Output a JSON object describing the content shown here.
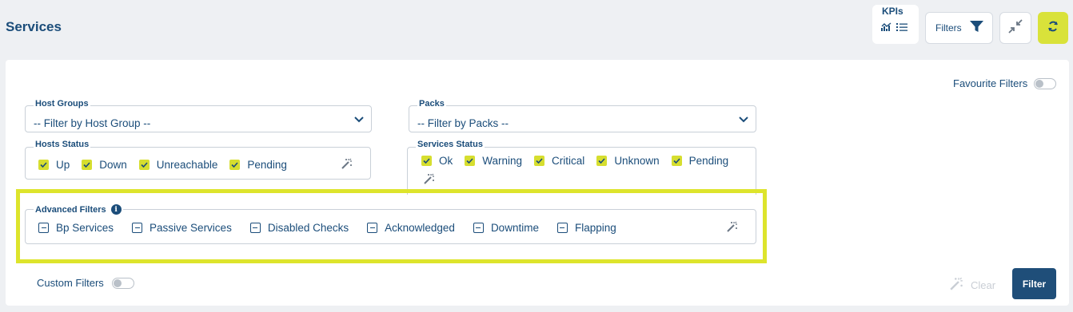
{
  "header": {
    "title": "Services",
    "kpis_label": "KPIs",
    "filters_button": "Filters"
  },
  "favourite_filters": {
    "label": "Favourite Filters",
    "enabled": false
  },
  "host_groups": {
    "label": "Host Groups",
    "value": "-- Filter by Host Group --"
  },
  "packs": {
    "label": "Packs",
    "value": "-- Filter by Packs --"
  },
  "hosts_status": {
    "label": "Hosts Status",
    "options": [
      {
        "label": "Up",
        "checked": true
      },
      {
        "label": "Down",
        "checked": true
      },
      {
        "label": "Unreachable",
        "checked": true
      },
      {
        "label": "Pending",
        "checked": true
      }
    ]
  },
  "services_status": {
    "label": "Services Status",
    "options": [
      {
        "label": "Ok",
        "checked": true
      },
      {
        "label": "Warning",
        "checked": true
      },
      {
        "label": "Critical",
        "checked": true
      },
      {
        "label": "Unknown",
        "checked": true
      },
      {
        "label": "Pending",
        "checked": true
      }
    ]
  },
  "advanced_filters": {
    "label": "Advanced Filters",
    "options": [
      {
        "label": "Bp Services",
        "state": "indeterminate"
      },
      {
        "label": "Passive Services",
        "state": "indeterminate"
      },
      {
        "label": "Disabled Checks",
        "state": "indeterminate"
      },
      {
        "label": "Acknowledged",
        "state": "indeterminate"
      },
      {
        "label": "Downtime",
        "state": "indeterminate"
      },
      {
        "label": "Flapping",
        "state": "indeterminate"
      }
    ]
  },
  "custom_filters": {
    "label": "Custom Filters",
    "enabled": false
  },
  "actions": {
    "clear": "Clear",
    "filter": "Filter"
  },
  "colors": {
    "accent": "#d9e23a",
    "primary": "#1f4e79",
    "text": "#1b4d7a"
  }
}
